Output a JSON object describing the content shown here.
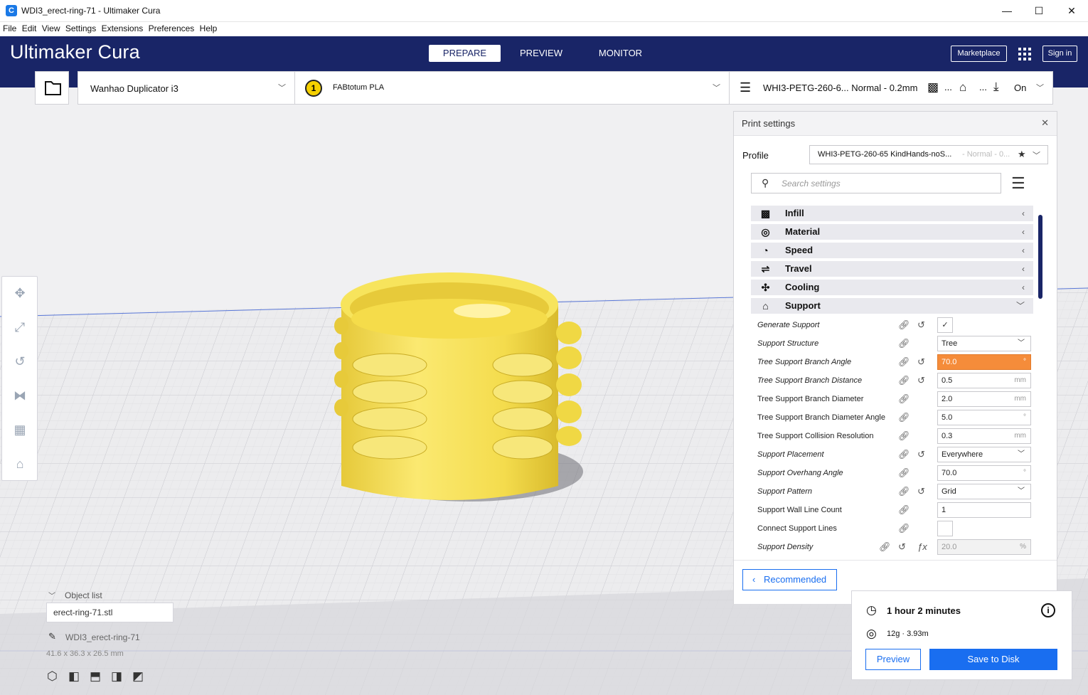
{
  "window": {
    "title": "WDI3_erect-ring-71 - Ultimaker Cura",
    "app_icon": "C",
    "minimize": "—",
    "maximize": "☐",
    "close": "✕"
  },
  "menu": [
    "File",
    "Edit",
    "View",
    "Settings",
    "Extensions",
    "Preferences",
    "Help"
  ],
  "header": {
    "logo_a": "Ultimaker",
    "logo_b": "Cura",
    "stages": [
      "PREPARE",
      "PREVIEW",
      "MONITOR"
    ],
    "marketplace": "Marketplace",
    "sign_in": "Sign in"
  },
  "toolbar": {
    "printer": "Wanhao Duplicator i3",
    "extruder_number": "1",
    "material": "FABtotum PLA",
    "profile_summary": "WHI3-PETG-260-6... Normal - 0.2mm",
    "ellipsis_1": "...",
    "ellipsis_2": "...",
    "adhesion": "On"
  },
  "print_settings": {
    "title": "Print settings",
    "profile_label": "Profile",
    "profile_value": "WHI3-PETG-260-65 KindHands-noS...",
    "profile_suffix": "- Normal - 0...",
    "search_placeholder": "Search settings",
    "categories": [
      {
        "label": "Infill",
        "icon": "infill-icon"
      },
      {
        "label": "Material",
        "icon": "material-icon"
      },
      {
        "label": "Speed",
        "icon": "speed-icon"
      },
      {
        "label": "Travel",
        "icon": "travel-icon"
      },
      {
        "label": "Cooling",
        "icon": "cooling-icon"
      },
      {
        "label": "Support",
        "icon": "support-icon"
      }
    ],
    "settings": [
      {
        "label": "Generate Support",
        "value": "✓"
      },
      {
        "label": "Support Structure",
        "value": "Tree"
      },
      {
        "label": "Tree Support Branch Angle",
        "value": "70.0",
        "unit": "°"
      },
      {
        "label": "Tree Support Branch Distance",
        "value": "0.5",
        "unit": "mm"
      },
      {
        "label": "Tree Support Branch Diameter",
        "value": "2.0",
        "unit": "mm"
      },
      {
        "label": "Tree Support Branch Diameter Angle",
        "value": "5.0",
        "unit": "°"
      },
      {
        "label": "Tree Support Collision Resolution",
        "value": "0.3",
        "unit": "mm"
      },
      {
        "label": "Support Placement",
        "value": "Everywhere"
      },
      {
        "label": "Support Overhang Angle",
        "value": "70.0",
        "unit": "°"
      },
      {
        "label": "Support Pattern",
        "value": "Grid"
      },
      {
        "label": "Support Wall Line Count",
        "value": "1"
      },
      {
        "label": "Connect Support Lines",
        "value": ""
      },
      {
        "label": "Support Density",
        "value": "20.0",
        "unit": "%"
      }
    ],
    "recommended": "Recommended"
  },
  "object_list": {
    "header": "Object list",
    "file": "erect-ring-71.stl",
    "name": "WDI3_erect-ring-71",
    "dimensions": "41.6 x 36.3 x 26.5 mm"
  },
  "job": {
    "time": "1 hour 2 minutes",
    "material": "12g · 3.93m",
    "preview": "Preview",
    "save": "Save to Disk"
  },
  "colors": {
    "header": "#192567",
    "accent": "#196ef0",
    "model": "#f5e046",
    "highlight": "#f58c3a"
  }
}
